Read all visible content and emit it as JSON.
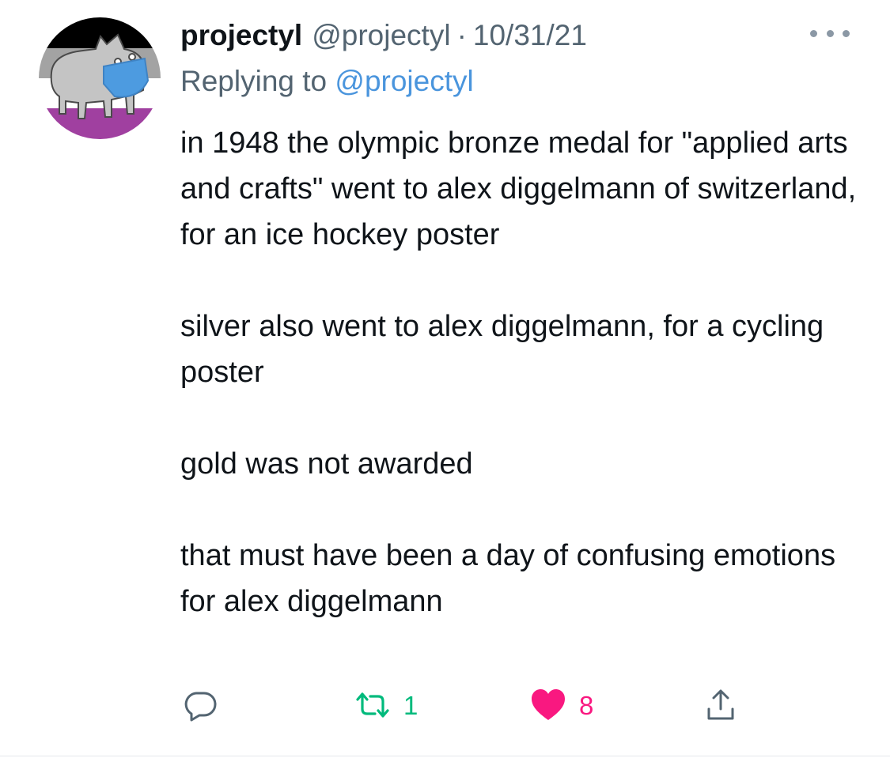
{
  "tweet": {
    "author": {
      "display_name": "projectyl",
      "handle": "@projectyl",
      "avatar": "asexual-flag-pixel-creature-avatar"
    },
    "separator": "·",
    "date": "10/31/21",
    "more_icon": "more-horizontal-icon",
    "reply_to": {
      "prefix": "Replying to ",
      "handle": "@projectyl"
    },
    "text": {
      "paragraphs": [
        "in 1948 the olympic bronze medal for \"applied arts and crafts\" went to alex diggelmann of switzerland, for an ice hockey poster",
        "silver also went to alex diggelmann, for a cycling poster",
        "gold was not awarded",
        "that must have been a day of confusing emotions for alex diggelmann"
      ]
    },
    "actions": {
      "reply": {
        "icon": "reply-bubble-icon",
        "count": ""
      },
      "retweet": {
        "icon": "retweet-icon",
        "count": "1",
        "color": "#00ba7c"
      },
      "like": {
        "icon": "heart-icon",
        "count": "8",
        "color": "#f91880",
        "liked": true
      },
      "share": {
        "icon": "share-icon"
      }
    },
    "colors": {
      "text": "#0f1419",
      "secondary": "#536471",
      "link": "#4a95dd"
    }
  }
}
